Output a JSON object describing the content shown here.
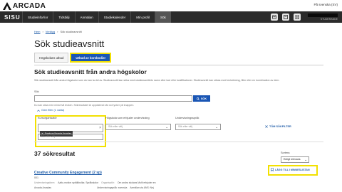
{
  "brand": {
    "logo_text": "ARCADA",
    "lang_link": "På svenska (SV)"
  },
  "nav": {
    "app_name": "SISU",
    "items": [
      {
        "label": "Studieinfo/rior"
      },
      {
        "label": "Tidsbilji"
      },
      {
        "label": "Anmälan"
      },
      {
        "label": "Studiekalender"
      },
      {
        "label": "Min profil"
      },
      {
        "label": "Sök"
      }
    ],
    "icons": [
      "notification-icon",
      "message-icon",
      "grid-icon"
    ],
    "user_id": "STUDERANDE"
  },
  "breadcrumb": {
    "home": "Hem",
    "tools": "Verktyg",
    "current": "Sök studieavsnitt"
  },
  "page": {
    "title": "Sök studieavsnitt"
  },
  "tabs": [
    {
      "label": "Högskolans utbud",
      "selected": false
    },
    {
      "label": "Utbud av korsbodier",
      "selected": true
    }
  ],
  "section": {
    "heading": "Sök studieavsnitt från andra högskolor",
    "description": "Sök studieavsnitt från andra högskolor som du kan ta del av. Studieavsnitt kan söka med studieavsnittets namn eller kod eller kvalifikationer. Studieavsnitt kan sökas med textsökning, filter eller en kombination av dem."
  },
  "search": {
    "label": "Sök",
    "placeholder": "",
    "button": "SÖK",
    "hint": "Du kan söka med minst två tecken. Sökresultatet är uppdaterat när du trycker på knappen."
  },
  "filters": {
    "toggle_label": "Göm filter (1 valda)",
    "organizer": {
      "label": "Kursorganisatör",
      "chip": "Samkurs/Arcada Arcadas",
      "placeholder": "Sök eller välj"
    },
    "lang": {
      "label": "Högskola som erbjuder undervisning",
      "value": "Sök eller välj"
    },
    "field": {
      "label": "Undervisningsspråk",
      "value": "Sök eller välj"
    },
    "clear_label": "TÖM SÖKFILTER"
  },
  "results": {
    "count_text": "37 sökresultat",
    "sort_label": "Sortera",
    "sort_value": "Enligt relevans",
    "add_button": "LÄGG TILL I MINNESLISTAN",
    "first": {
      "title": "Creative Community Engagement (2 sp)",
      "code": "001",
      "meta1_key": "Undervisningsform:",
      "meta1_val": "Aalto-motion språlkbollar, Språkskolor",
      "meta1_key2": "Organisatör:",
      "meta1_val2": "Om andra skolans Multi erbjuder en",
      "meta2_key": "Arcada Arcadas",
      "meta2_val": "Undervisningspråk: svenska",
      "meta2_val2": "Anmälan via ANS: Nej"
    }
  }
}
